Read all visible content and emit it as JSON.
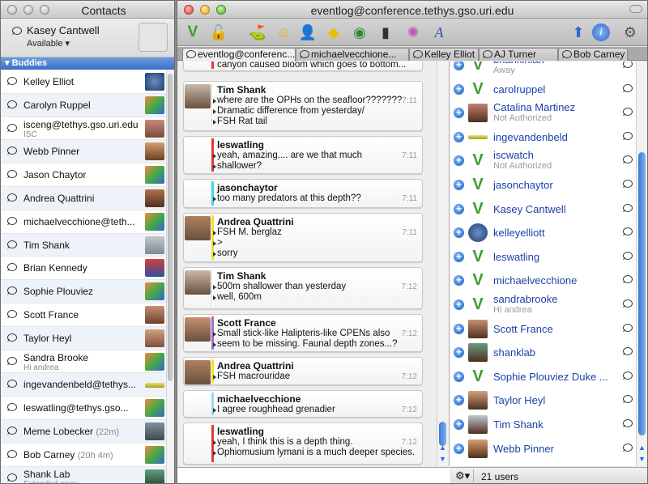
{
  "contacts_window": {
    "title": "Contacts",
    "me": {
      "name": "Kasey Cantwell",
      "status": "Available"
    },
    "group": "Buddies",
    "buddies": [
      {
        "name": "Kelley Elliot",
        "sub": "",
        "idle": ""
      },
      {
        "name": "Carolyn Ruppel",
        "sub": "",
        "idle": ""
      },
      {
        "name": "isceng@tethys.gso.uri.edu",
        "sub": "ISC",
        "idle": ""
      },
      {
        "name": "Webb Pinner",
        "sub": "",
        "idle": ""
      },
      {
        "name": "Jason Chaytor",
        "sub": "",
        "idle": ""
      },
      {
        "name": "Andrea Quattrini",
        "sub": "",
        "idle": ""
      },
      {
        "name": "michaelvecchione@teth...",
        "sub": "",
        "idle": ""
      },
      {
        "name": "Tim Shank",
        "sub": "",
        "idle": ""
      },
      {
        "name": "Brian Kennedy",
        "sub": "",
        "idle": ""
      },
      {
        "name": "Sophie Plouviez",
        "sub": "",
        "idle": ""
      },
      {
        "name": "Scott France",
        "sub": "",
        "idle": ""
      },
      {
        "name": "Taylor Heyl",
        "sub": "",
        "idle": ""
      },
      {
        "name": "Sandra Brooke",
        "sub": "Hi andrea",
        "idle": ""
      },
      {
        "name": "ingevandenbeld@tethys...",
        "sub": "",
        "idle": ""
      },
      {
        "name": "leswatling@tethys.gso...",
        "sub": "",
        "idle": ""
      },
      {
        "name": "Meme Lobecker",
        "sub": "",
        "idle": "(22m)"
      },
      {
        "name": "Bob Carney",
        "sub": "",
        "idle": "(20h 4m)"
      },
      {
        "name": "Shank Lab",
        "sub": "Extended away",
        "idle": ""
      }
    ]
  },
  "chat_window": {
    "title": "eventlog@conference.tethys.gso.uri.edu",
    "tabs": [
      {
        "label": "eventlog@conferenc..."
      },
      {
        "label": "michaelvecchione..."
      },
      {
        "label": "Kelley Elliot"
      },
      {
        "label": "AJ Turner"
      },
      {
        "label": "Bob Carney"
      }
    ],
    "messages": [
      {
        "sender": "",
        "lines": [
          "canyon caused bloom which goes to bottom..."
        ],
        "time": "",
        "color": "#e03a3a"
      },
      {
        "sender": "Tim Shank",
        "lines": [
          "where are the OPHs on the seafloor???????",
          " Dramatic difference from yesterday/",
          "FSH Rat tail"
        ],
        "time": "7:11",
        "color": "#ffffff"
      },
      {
        "sender": "leswatling",
        "lines": [
          "yeah, amazing.... are we that much",
          "shallower?"
        ],
        "time": "7:11",
        "color": "#e03a3a"
      },
      {
        "sender": "jasonchaytor",
        "lines": [
          "too many predators at this depth??"
        ],
        "time": "7:11",
        "color": "#3fd8e8"
      },
      {
        "sender": "Andrea Quattrini",
        "lines": [
          "FSH M. berglaz",
          ">",
          "sorry"
        ],
        "time": "7:11",
        "color": "#f2e02a"
      },
      {
        "sender": "Tim Shank",
        "lines": [
          "500m shallower than yesterday",
          "well, 600m"
        ],
        "time": "7:12",
        "color": "#ffffff"
      },
      {
        "sender": "Scott France",
        "lines": [
          "Small stick-like Halipteris-like CPENs also",
          "seem to be missing. Faunal depth zones...?"
        ],
        "time": "7:12",
        "color": "#9b6fd6"
      },
      {
        "sender": "Andrea Quattrini",
        "lines": [
          "FSH macrouridae"
        ],
        "time": "7:12",
        "color": "#f2e02a"
      },
      {
        "sender": "michaelvecchione",
        "lines": [
          "I agree roughhead grenadier"
        ],
        "time": "7:12",
        "color": "#9ed6ee"
      },
      {
        "sender": "leswatling",
        "lines": [
          "yeah, I think this is a depth thing.",
          "Ophiomusium lymani is a much deeper species."
        ],
        "time": "7:12",
        "color": "#e03a3a"
      }
    ],
    "users": [
      {
        "name": "briankinlan",
        "sub": "Away"
      },
      {
        "name": "carolruppel",
        "sub": ""
      },
      {
        "name": "Catalina Martinez",
        "sub": "Not Authorized"
      },
      {
        "name": "ingevandenbeld",
        "sub": ""
      },
      {
        "name": "iscwatch",
        "sub": "Not Authorized"
      },
      {
        "name": "jasonchaytor",
        "sub": ""
      },
      {
        "name": "Kasey Cantwell",
        "sub": ""
      },
      {
        "name": "kelleyelliott",
        "sub": ""
      },
      {
        "name": "leswatling",
        "sub": ""
      },
      {
        "name": "michaelvecchione",
        "sub": ""
      },
      {
        "name": "sandrabrooke",
        "sub": "Hi andrea"
      },
      {
        "name": "Scott France",
        "sub": ""
      },
      {
        "name": "shanklab",
        "sub": ""
      },
      {
        "name": "Sophie Plouviez Duke ...",
        "sub": ""
      },
      {
        "name": "Taylor Heyl",
        "sub": ""
      },
      {
        "name": "Tim Shank",
        "sub": ""
      },
      {
        "name": "Webb Pinner",
        "sub": ""
      }
    ],
    "user_count": "21 users"
  },
  "colors": {
    "link_blue": "#1b3fa8",
    "selection_blue": "#3c6fc8"
  }
}
